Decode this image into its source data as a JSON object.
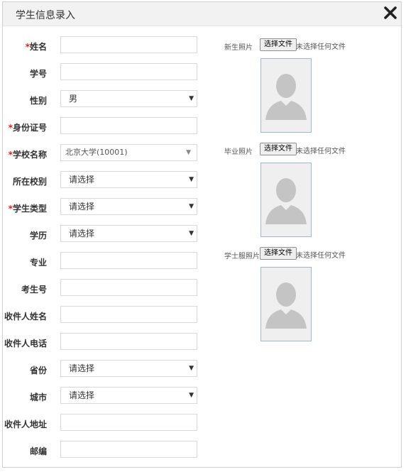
{
  "dialog": {
    "title": "学生信息录入"
  },
  "form": {
    "required_mark": "*",
    "fields": [
      {
        "label": "姓名",
        "required": true,
        "type": "text",
        "value": ""
      },
      {
        "label": "学号",
        "required": false,
        "type": "text",
        "value": ""
      },
      {
        "label": "性别",
        "required": false,
        "type": "select",
        "value": "男"
      },
      {
        "label": "身份证号",
        "required": true,
        "type": "text",
        "value": ""
      },
      {
        "label": "学校名称",
        "required": true,
        "type": "select",
        "value": "北京大学(10001)"
      },
      {
        "label": "所在校别",
        "required": false,
        "type": "select",
        "value": "请选择"
      },
      {
        "label": "学生类型",
        "required": true,
        "type": "select",
        "value": "请选择"
      },
      {
        "label": "学历",
        "required": false,
        "type": "select",
        "value": "请选择"
      },
      {
        "label": "专业",
        "required": false,
        "type": "text",
        "value": ""
      },
      {
        "label": "考生号",
        "required": false,
        "type": "text",
        "value": ""
      },
      {
        "label": "收件人姓名",
        "required": false,
        "type": "text",
        "value": ""
      },
      {
        "label": "收件人电话",
        "required": false,
        "type": "text",
        "value": ""
      },
      {
        "label": "省份",
        "required": false,
        "type": "select",
        "value": "请选择"
      },
      {
        "label": "城市",
        "required": false,
        "type": "select",
        "value": "请选择"
      },
      {
        "label": "收件人地址",
        "required": false,
        "type": "text",
        "value": ""
      },
      {
        "label": "邮编",
        "required": false,
        "type": "text",
        "value": ""
      }
    ]
  },
  "photos": [
    {
      "label": "新生照片",
      "button": "选择文件",
      "status": "未选择任何文件"
    },
    {
      "label": "毕业照片",
      "button": "选择文件",
      "status": "未选择任何文件"
    },
    {
      "label": "学士服照片",
      "button": "选择文件",
      "status": "未选择任何文件"
    }
  ],
  "icons": {
    "close": "close-icon",
    "dropdown": "chevron-down-icon",
    "avatar": "person-silhouette-icon"
  },
  "colors": {
    "required": "#e02020",
    "titlebar_bg": "#f2f2f2",
    "avatar_border": "#9fb6d6",
    "avatar_figure": "#c4c4c4"
  }
}
